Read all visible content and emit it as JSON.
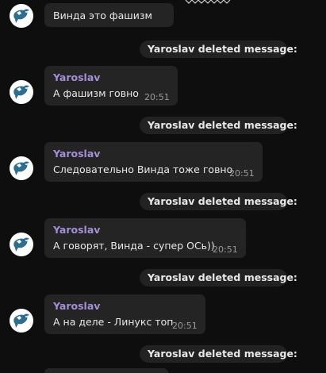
{
  "colors": {
    "background": "#0e0e0e",
    "bubble": "#242424",
    "sender": "#a48fd6",
    "service": "#222222",
    "avatar_icon": "#2d6d8d"
  },
  "avatar_icon": "bird-flag-icon",
  "messages": [
    {
      "sender": "",
      "text": "Винда это фашизм",
      "time": ""
    },
    {
      "sender": "Yaroslav",
      "text": "А фашизм говно",
      "time": "20:51"
    },
    {
      "sender": "Yaroslav",
      "text": "Следовательно Винда тоже говно",
      "time": "20:51"
    },
    {
      "sender": "Yaroslav",
      "text": "А говорят, Винда - супер ОСь))",
      "time": "20:51"
    },
    {
      "sender": "Yaroslav",
      "text": "А на деле - Линукс топ",
      "time": "20:51"
    }
  ],
  "service_messages": [
    {
      "text": "Yaroslav deleted message:"
    },
    {
      "text": "Yaroslav deleted message:"
    },
    {
      "text": "Yaroslav deleted message:"
    },
    {
      "text": "Yaroslav deleted message:"
    },
    {
      "text": "Yaroslav deleted message:"
    }
  ]
}
